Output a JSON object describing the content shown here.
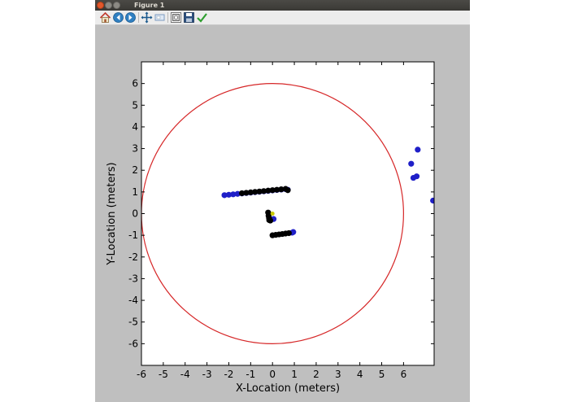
{
  "window": {
    "title": "Figure 1"
  },
  "toolbar": {
    "buttons": [
      {
        "name": "home-button",
        "icon": "home-icon"
      },
      {
        "name": "back-button",
        "icon": "back-arrow-icon"
      },
      {
        "name": "forward-button",
        "icon": "forward-arrow-icon"
      },
      {
        "name": "pan-button",
        "icon": "pan-move-icon"
      },
      {
        "name": "zoom-button",
        "icon": "zoom-rect-icon"
      },
      {
        "name": "subplots-button",
        "icon": "configure-subplots-icon"
      },
      {
        "name": "save-button",
        "icon": "save-floppy-icon"
      },
      {
        "name": "edit-button",
        "icon": "checkmark-icon"
      }
    ]
  },
  "chart_data": {
    "type": "scatter",
    "xlabel": "X-Location (meters)",
    "ylabel": "Y-Location (meters)",
    "xlim": [
      -6,
      7.4
    ],
    "ylim": [
      -7,
      7
    ],
    "xticks": [
      -6,
      -5,
      -4,
      -3,
      -2,
      -1,
      0,
      1,
      2,
      3,
      4,
      5,
      6
    ],
    "yticks": [
      6,
      5,
      4,
      3,
      2,
      1,
      0,
      -1,
      -2,
      -3,
      -4,
      -5,
      -6
    ],
    "grid": false,
    "circle": {
      "center": [
        0,
        0
      ],
      "radius": 6,
      "color": "#d62728"
    },
    "colors": {
      "blue": "#1f1fc8",
      "black": "#000000",
      "yellow": "#c8c800"
    },
    "series": [
      {
        "color": "blue",
        "x": [
          -2.2,
          -2.0,
          -1.8,
          -1.6,
          -1.4,
          -1.2,
          -1.0,
          -0.8,
          -0.6,
          -0.4,
          -0.2,
          0.0,
          0.2,
          0.4,
          0.6,
          0.7,
          0.05,
          0.95,
          0.9,
          6.35,
          6.45,
          6.6,
          6.65,
          7.35
        ],
        "y": [
          0.85,
          0.87,
          0.89,
          0.91,
          0.93,
          0.95,
          0.97,
          0.99,
          1.01,
          1.03,
          1.05,
          1.07,
          1.09,
          1.11,
          1.13,
          1.1,
          -0.25,
          -0.85,
          -0.88,
          2.3,
          1.65,
          1.72,
          2.95,
          0.6
        ]
      },
      {
        "color": "black",
        "x": [
          -1.4,
          -1.2,
          -1.0,
          -0.8,
          -0.6,
          -0.4,
          -0.2,
          0.0,
          0.2,
          0.4,
          0.6,
          0.7,
          -0.2,
          -0.18,
          -0.16,
          -0.15,
          -0.1,
          0.0,
          0.15,
          0.3,
          0.45,
          0.6,
          0.75
        ],
        "y": [
          0.94,
          0.96,
          0.98,
          1.0,
          1.02,
          1.04,
          1.06,
          1.08,
          1.1,
          1.12,
          1.14,
          1.08,
          0.05,
          -0.1,
          -0.2,
          -0.3,
          -0.32,
          -1.0,
          -0.98,
          -0.96,
          -0.94,
          -0.92,
          -0.9
        ]
      },
      {
        "color": "yellow",
        "x": [
          0.0
        ],
        "y": [
          0.0
        ]
      }
    ]
  }
}
